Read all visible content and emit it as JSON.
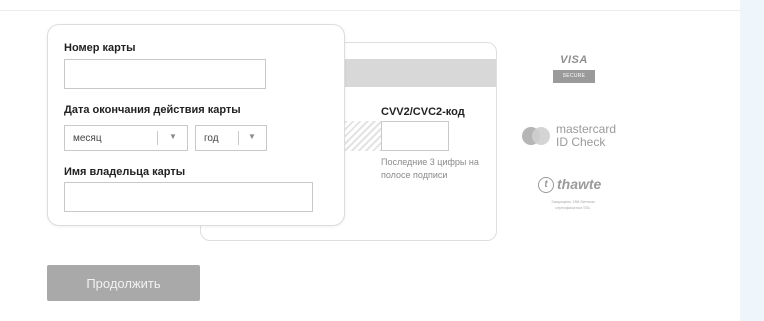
{
  "form": {
    "card_number_label": "Номер карты",
    "card_number_value": "",
    "expiry_label": "Дата окончания действия карты",
    "month_select": "месяц",
    "year_select": "год",
    "holder_label": "Имя владельца карты",
    "holder_value": ""
  },
  "card_back": {
    "cvv_label": "CVV2/CVC2-код",
    "cvv_value": "",
    "cvv_hint": "Последние 3 цифры на полосе подписи"
  },
  "logos": {
    "visa": "VISA",
    "visa_badge": "SECURE",
    "mastercard_line1": "mastercard",
    "mastercard_line2": "ID Check",
    "thawte": "thawte",
    "thawte_mark": "t",
    "thawte_fine": "Защищено 256-битным сертификатом SSL"
  },
  "actions": {
    "continue_label": "Продолжить"
  },
  "colors": {
    "button_bg": "#a9a9a9",
    "mag_stripe": "#d8d8d8",
    "right_gutter": "#eef5fb"
  }
}
